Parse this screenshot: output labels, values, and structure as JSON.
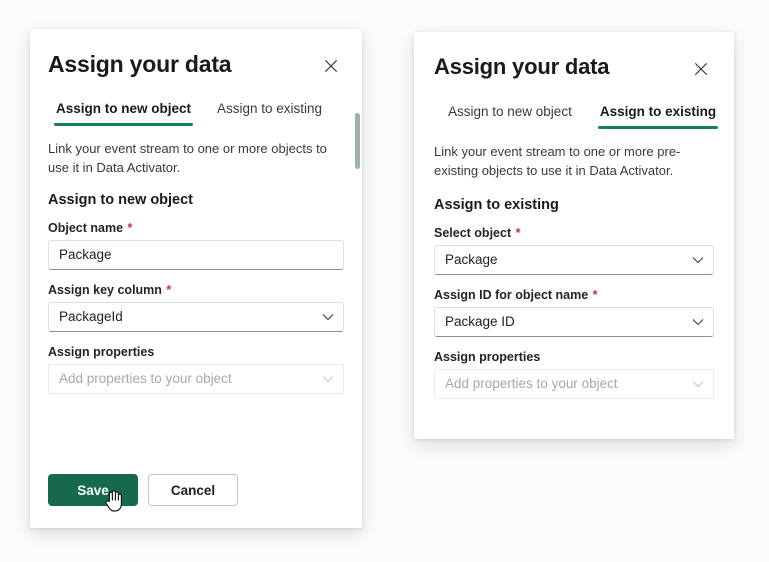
{
  "panels": [
    {
      "id": "new-object",
      "title": "Assign your data",
      "close_icon": "close-icon",
      "tabs": [
        {
          "label": "Assign to new object",
          "active": true
        },
        {
          "label": "Assign to existing",
          "active": false
        }
      ],
      "description": "Link your event stream to one or more objects to use it in Data Activator.",
      "section_title": "Assign to new object",
      "fields": [
        {
          "label": "Object name",
          "required": true,
          "type": "text",
          "value": "Package",
          "disabled": false
        },
        {
          "label": "Assign key column",
          "required": true,
          "type": "select",
          "value": "PackageId",
          "disabled": false
        },
        {
          "label": "Assign properties",
          "required": false,
          "type": "select",
          "value": "Add properties to your object",
          "disabled": true
        }
      ],
      "buttons": [
        {
          "label": "Save",
          "style": "primary"
        },
        {
          "label": "Cancel",
          "style": "secondary"
        }
      ],
      "has_scrollbar": true
    },
    {
      "id": "existing-object",
      "title": "Assign your data",
      "close_icon": "close-icon",
      "tabs": [
        {
          "label": "Assign to new object",
          "active": false
        },
        {
          "label": "Assign to existing",
          "active": true
        }
      ],
      "description": "Link your event stream to one or more pre-existing objects to use it in Data Activator.",
      "section_title": "Assign to existing",
      "fields": [
        {
          "label": "Select object",
          "required": true,
          "type": "select",
          "value": "Package",
          "disabled": false
        },
        {
          "label": "Assign ID for object name",
          "required": true,
          "type": "select",
          "value": "Package ID",
          "disabled": false
        },
        {
          "label": "Assign properties",
          "required": false,
          "type": "select",
          "value": "Add properties to your object",
          "disabled": true
        }
      ],
      "buttons": [],
      "has_scrollbar": false
    }
  ],
  "colors": {
    "accent_green": "#127e65",
    "primary_button": "#16694f",
    "required_asterisk": "#c4314b",
    "scrollbar_thumb": "#9cb3ac",
    "page_background": "#fcfcfc"
  },
  "cursor": {
    "icon": "pointing-hand-cursor",
    "over": "Save"
  }
}
